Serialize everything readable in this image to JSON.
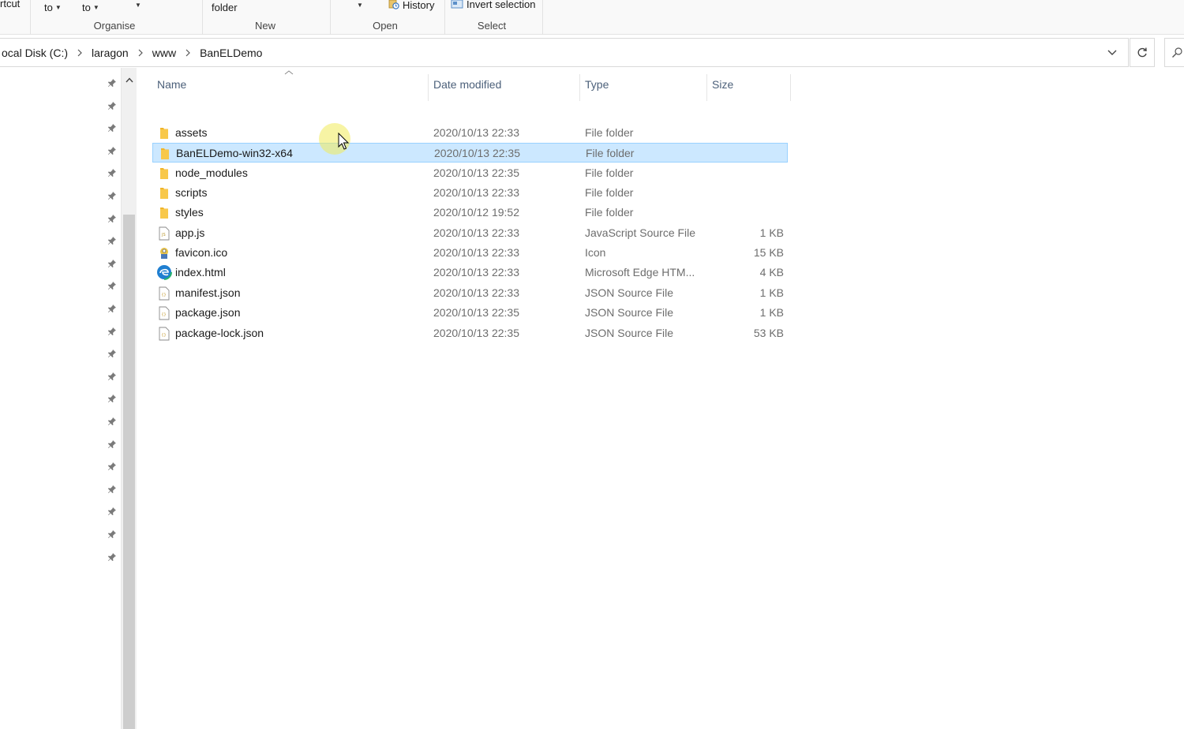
{
  "ribbon": {
    "shortcut_partial": "rtcut",
    "move_to": "to",
    "copy_to": "to",
    "new_folder_partial": "folder",
    "history": "History",
    "invert_selection": "Invert selection",
    "groups": {
      "organise": "Organise",
      "new": "New",
      "open": "Open",
      "select": "Select"
    }
  },
  "address": {
    "crumbs": [
      "ocal Disk (C:)",
      "laragon",
      "www",
      "BanELDemo"
    ]
  },
  "columns": {
    "name": "Name",
    "date": "Date modified",
    "type": "Type",
    "size": "Size"
  },
  "files": [
    {
      "name": "assets",
      "date": "2020/10/13 22:33",
      "type": "File folder",
      "size": "",
      "icon": "folder-icon",
      "selected": false
    },
    {
      "name": "BanELDemo-win32-x64",
      "date": "2020/10/13 22:35",
      "type": "File folder",
      "size": "",
      "icon": "folder-icon",
      "selected": true
    },
    {
      "name": "node_modules",
      "date": "2020/10/13 22:35",
      "type": "File folder",
      "size": "",
      "icon": "folder-icon",
      "selected": false
    },
    {
      "name": "scripts",
      "date": "2020/10/13 22:33",
      "type": "File folder",
      "size": "",
      "icon": "folder-icon",
      "selected": false
    },
    {
      "name": "styles",
      "date": "2020/10/12 19:52",
      "type": "File folder",
      "size": "",
      "icon": "folder-icon",
      "selected": false
    },
    {
      "name": "app.js",
      "date": "2020/10/13 22:33",
      "type": "JavaScript Source File",
      "size": "1 KB",
      "icon": "js-file-icon",
      "selected": false
    },
    {
      "name": "favicon.ico",
      "date": "2020/10/13 22:33",
      "type": "Icon",
      "size": "15 KB",
      "icon": "ico-file-icon",
      "selected": false
    },
    {
      "name": "index.html",
      "date": "2020/10/13 22:33",
      "type": "Microsoft Edge HTM...",
      "size": "4 KB",
      "icon": "edge-html-icon",
      "selected": false
    },
    {
      "name": "manifest.json",
      "date": "2020/10/13 22:33",
      "type": "JSON Source File",
      "size": "1 KB",
      "icon": "json-file-icon",
      "selected": false
    },
    {
      "name": "package.json",
      "date": "2020/10/13 22:35",
      "type": "JSON Source File",
      "size": "1 KB",
      "icon": "json-file-icon",
      "selected": false
    },
    {
      "name": "package-lock.json",
      "date": "2020/10/13 22:35",
      "type": "JSON Source File",
      "size": "53 KB",
      "icon": "json-file-icon",
      "selected": false
    }
  ],
  "colors": {
    "selection_bg": "#cce8ff",
    "selection_border": "#99d1ff",
    "folder": "#f8c84a",
    "header_text": "#4c607a"
  }
}
